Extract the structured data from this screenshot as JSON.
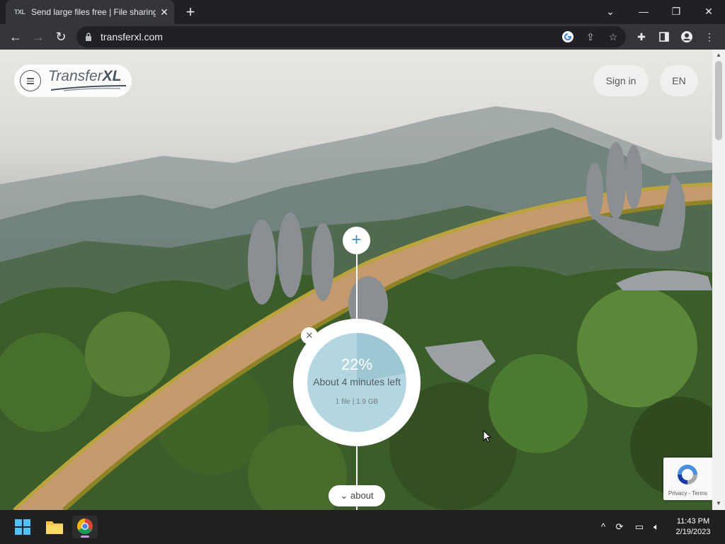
{
  "browser": {
    "tab": {
      "favicon_text": "TXL",
      "title": "Send large files free | File sharing"
    },
    "url": "transferxl.com"
  },
  "site": {
    "logo": {
      "part1": "Transfer",
      "part2": "XL"
    },
    "header": {
      "sign_in": "Sign in",
      "language": "EN"
    }
  },
  "upload": {
    "progress_percent": "22%",
    "progress_fraction": 0.22,
    "eta": "About 4 minutes left",
    "file_info": "1 file | 1.9 GB",
    "about_label": "about"
  },
  "recaptcha": {
    "privacy": "Privacy",
    "separator": " - ",
    "terms": "Terms"
  },
  "taskbar": {
    "time": "11:43 PM",
    "date": "2/19/2023"
  },
  "colors": {
    "progress_ring": "#ffffff",
    "progress_fill": "#b4d6e0",
    "progress_done": "#9ec7d4",
    "accent_blue": "#3a8fd6"
  },
  "icons": [
    "windows-start-icon",
    "file-explorer-icon",
    "chrome-icon",
    "google-icon",
    "share-icon",
    "star-icon",
    "extensions-icon",
    "sidepanel-icon",
    "profile-icon"
  ]
}
